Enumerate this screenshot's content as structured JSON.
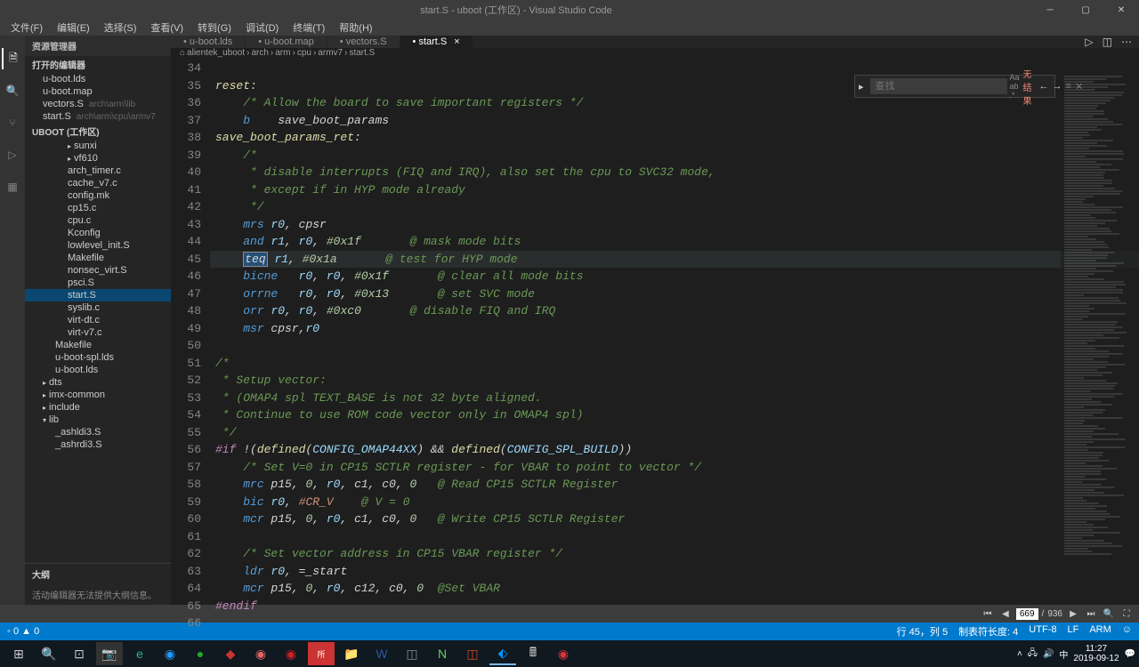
{
  "titlebar": {
    "title": "start.S - uboot (工作区) - Visual Studio Code"
  },
  "menubar": [
    "文件(F)",
    "编辑(E)",
    "选择(S)",
    "查看(V)",
    "转到(G)",
    "调试(D)",
    "终端(T)",
    "帮助(H)"
  ],
  "sidebar": {
    "header": "资源管理器",
    "section1": "打开的编辑器",
    "openEditors": [
      {
        "label": "u-boot.lds"
      },
      {
        "label": "u-boot.map"
      },
      {
        "label": "vectors.S",
        "hint": "arch\\arm\\lib"
      },
      {
        "label": "start.S",
        "hint": "arch\\arm\\cpu\\armv7"
      }
    ],
    "section2": "UBOOT (工作区)",
    "tree": [
      {
        "label": "sunxi",
        "type": "folder",
        "indent": 2
      },
      {
        "label": "vf610",
        "type": "folder",
        "indent": 2
      },
      {
        "label": "arch_timer.c",
        "type": "file",
        "indent": 2
      },
      {
        "label": "cache_v7.c",
        "type": "file",
        "indent": 2
      },
      {
        "label": "config.mk",
        "type": "file",
        "indent": 2
      },
      {
        "label": "cp15.c",
        "type": "file",
        "indent": 2
      },
      {
        "label": "cpu.c",
        "type": "file",
        "indent": 2
      },
      {
        "label": "Kconfig",
        "type": "file",
        "indent": 2
      },
      {
        "label": "lowlevel_init.S",
        "type": "file",
        "indent": 2
      },
      {
        "label": "Makefile",
        "type": "file",
        "indent": 2
      },
      {
        "label": "nonsec_virt.S",
        "type": "file",
        "indent": 2
      },
      {
        "label": "psci.S",
        "type": "file",
        "indent": 2
      },
      {
        "label": "start.S",
        "type": "file",
        "indent": 2,
        "selected": true
      },
      {
        "label": "syslib.c",
        "type": "file",
        "indent": 2
      },
      {
        "label": "virt-dt.c",
        "type": "file",
        "indent": 2
      },
      {
        "label": "virt-v7.c",
        "type": "file",
        "indent": 2
      },
      {
        "label": "Makefile",
        "type": "file",
        "indent": 1
      },
      {
        "label": "u-boot-spl.lds",
        "type": "file",
        "indent": 1
      },
      {
        "label": "u-boot.lds",
        "type": "file",
        "indent": 1
      },
      {
        "label": "dts",
        "type": "folder",
        "indent": 0
      },
      {
        "label": "imx-common",
        "type": "folder",
        "indent": 0
      },
      {
        "label": "include",
        "type": "folder",
        "indent": 0
      },
      {
        "label": "lib",
        "type": "folder",
        "indent": 0,
        "open": true
      },
      {
        "label": "_ashldi3.S",
        "type": "file",
        "indent": 1
      },
      {
        "label": "_ashrdi3.S",
        "type": "file",
        "indent": 1
      }
    ],
    "outline": "大纲",
    "outlineMsg": "活动编辑器无法提供大纲信息。"
  },
  "tabs": [
    {
      "label": "u-boot.lds"
    },
    {
      "label": "u-boot.map"
    },
    {
      "label": "vectors.S"
    },
    {
      "label": "start.S",
      "active": true
    }
  ],
  "breadcrumb": [
    "alientek_uboot",
    "arch",
    "arm",
    "cpu",
    "armv7",
    "start.S"
  ],
  "find": {
    "placeholder": "查找",
    "result": "无结果"
  },
  "code": {
    "startLine": 34,
    "lines": [
      "",
      "<span class='c-label'>reset</span>:",
      "    <span class='c-cmt'>/* Allow the board to save important registers */</span>",
      "    <span class='c-kw'>b</span>    save_boot_params",
      "<span class='c-label'>save_boot_params_ret</span>:",
      "    <span class='c-cmt'>/*</span>",
      "<span class='c-cmt'>     * disable interrupts (FIQ and IRQ), also set the cpu to SVC32 mode,</span>",
      "<span class='c-cmt'>     * except if in HYP mode already</span>",
      "<span class='c-cmt'>     */</span>",
      "    <span class='c-kw'>mrs</span> <span class='c-reg'>r0</span>, cpsr",
      "    <span class='c-kw'>and</span> <span class='c-reg'>r1</span>, <span class='c-reg'>r0</span>, <span class='c-num'>#0x1f</span>       <span class='c-cmt'>@ mask mode bits</span>",
      "    <span class='c-sel'>teq</span> <span class='c-reg'>r1</span>, <span class='c-num'>#0x1a</span>       <span class='c-cmt'>@ test for HYP mode</span>",
      "    <span class='c-kw'>bicne</span>   <span class='c-reg'>r0</span>, <span class='c-reg'>r0</span>, <span class='c-num'>#0x1f</span>       <span class='c-cmt'>@ clear all mode bits</span>",
      "    <span class='c-kw'>orrne</span>   <span class='c-reg'>r0</span>, <span class='c-reg'>r0</span>, <span class='c-num'>#0x13</span>       <span class='c-cmt'>@ set SVC mode</span>",
      "    <span class='c-kw'>orr</span> <span class='c-reg'>r0</span>, <span class='c-reg'>r0</span>, <span class='c-num'>#0xc0</span>       <span class='c-cmt'>@ disable FIQ and IRQ</span>",
      "    <span class='c-kw'>msr</span> cpsr,<span class='c-reg'>r0</span>",
      "",
      "<span class='c-cmt'>/*</span>",
      "<span class='c-cmt'> * Setup vector:</span>",
      "<span class='c-cmt'> * (OMAP4 spl TEXT_BASE is not 32 byte aligned.</span>",
      "<span class='c-cmt'> * Continue to use ROM code vector only in OMAP4 spl)</span>",
      "<span class='c-cmt'> */</span>",
      "<span class='c-pp'>#if</span> !(<span class='c-func'>defined</span>(<span class='c-reg'>CONFIG_OMAP44XX</span>) && <span class='c-func'>defined</span>(<span class='c-reg'>CONFIG_SPL_BUILD</span>))",
      "    <span class='c-cmt'>/* Set V=0 in CP15 SCTLR register - for VBAR to point to vector */</span>",
      "    <span class='c-kw'>mrc</span> p15, <span class='c-num'>0</span>, <span class='c-reg'>r0</span>, c1, c0, <span class='c-num'>0</span>   <span class='c-cmt'>@ Read CP15 SCTLR Register</span>",
      "    <span class='c-kw'>bic</span> <span class='c-reg'>r0</span>, <span class='c-str'>#CR_V</span>    <span class='c-cmt'>@ V = 0</span>",
      "    <span class='c-kw'>mcr</span> p15, <span class='c-num'>0</span>, <span class='c-reg'>r0</span>, c1, c0, <span class='c-num'>0</span>   <span class='c-cmt'>@ Write CP15 SCTLR Register</span>",
      "",
      "    <span class='c-cmt'>/* Set vector address in CP15 VBAR register */</span>",
      "    <span class='c-kw'>ldr</span> <span class='c-reg'>r0</span>, =_start",
      "    <span class='c-kw'>mcr</span> p15, <span class='c-num'>0</span>, <span class='c-reg'>r0</span>, c12, c0, <span class='c-num'>0</span>  <span class='c-cmt'>@Set VBAR</span>",
      "<span class='c-pp'>#endif</span>",
      ""
    ],
    "highlightLine": 45
  },
  "statusbar": {
    "branch": "◦ 0 ▲ 0",
    "pos": "行 45，列 5",
    "spaces": "制表符长度: 4",
    "encoding": "UTF-8",
    "eol": "LF",
    "lang": "ARM",
    "feedback": "☺"
  },
  "pager": {
    "current": "669",
    "total": "936"
  },
  "taskbar": {
    "time": "11:27",
    "date": "2019-09-12"
  }
}
